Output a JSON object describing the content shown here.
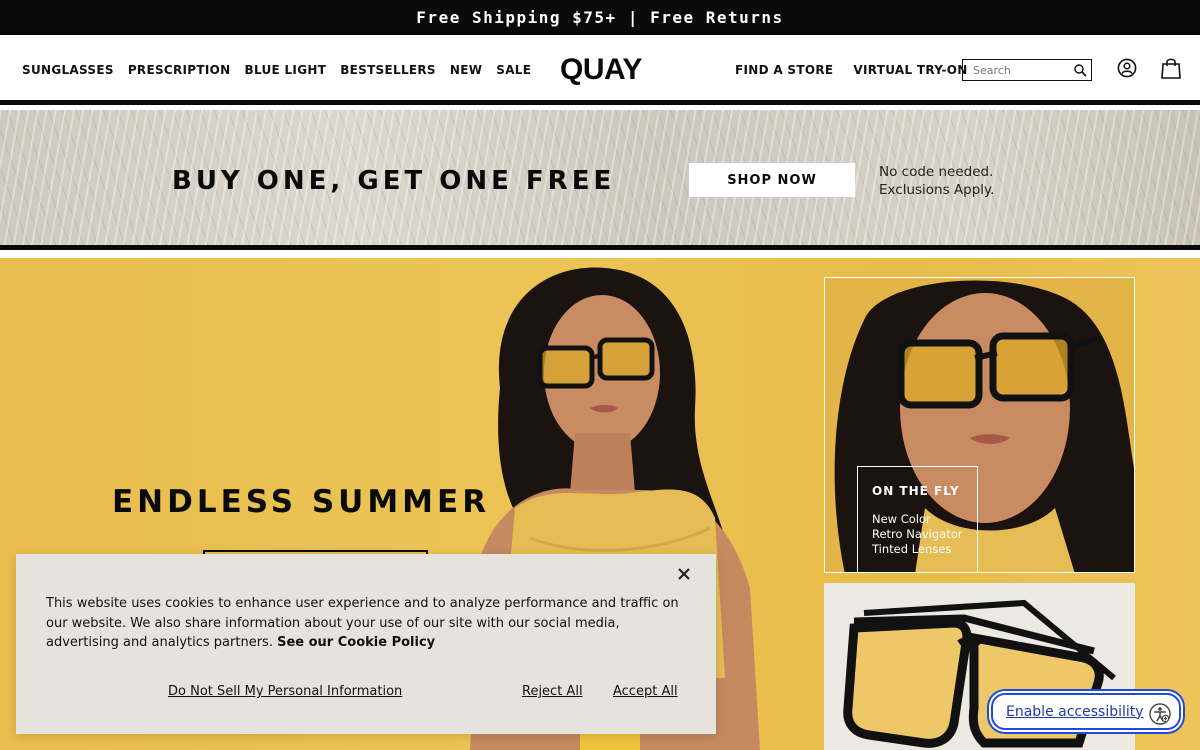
{
  "announcement": {
    "text": "Free Shipping $75+ | Free Returns"
  },
  "header": {
    "nav_left": [
      "SUNGLASSES",
      "PRESCRIPTION",
      "BLUE LIGHT",
      "BESTSELLERS",
      "NEW",
      "SALE"
    ],
    "logo": "QUAY",
    "nav_right": [
      "FIND A STORE",
      "VIRTUAL TRY-ON"
    ],
    "search_placeholder": "Search",
    "icons": {
      "search": "search-icon",
      "account": "account-icon",
      "bag": "shopping-bag-icon"
    }
  },
  "promo": {
    "title": "BUY ONE, GET ONE FREE",
    "button": "SHOP NOW",
    "note_line1": "No code needed.",
    "note_line2": "Exclusions Apply."
  },
  "hero": {
    "title": "ENDLESS SUMMER",
    "card1": {
      "title": "ON THE FLY",
      "line1": "New Color",
      "line2": "Retro Navigator",
      "line3": "Tinted Lenses"
    }
  },
  "cookie": {
    "text": "This website uses cookies to enhance user experience and to analyze performance and traffic on our website. We also share information about your use of our site with our social media, advertising and analytics partners.",
    "policy_link": "See our Cookie Policy",
    "do_not_sell": "Do Not Sell My Personal Information",
    "reject": "Reject All",
    "accept": "Accept All",
    "close_icon": "close-icon"
  },
  "accessibility": {
    "label": "Enable accessibility",
    "icon": "accessibility-icon"
  },
  "colors": {
    "black": "#0a0a0a",
    "hero_yellow": "#ecc456",
    "cookie_bg": "#e5e3dc",
    "a11y_blue": "#1f4bd8"
  }
}
